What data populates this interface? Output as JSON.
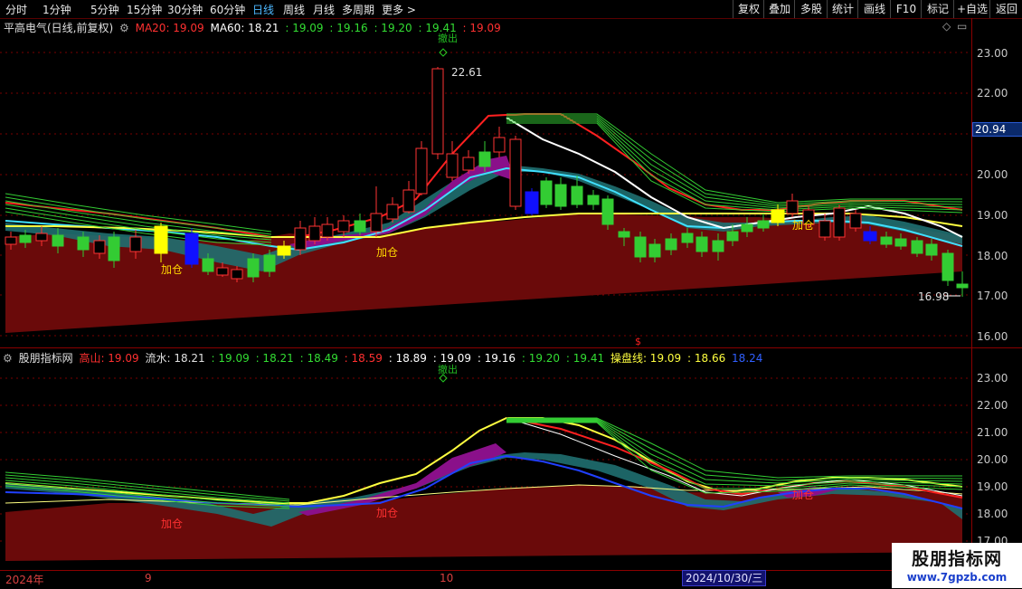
{
  "toolbar": {
    "periods": [
      "分时",
      "1分钟",
      "5分钟",
      "15分钟",
      "30分钟",
      "60分钟",
      "日线",
      "周线",
      "月线",
      "多周期",
      "更多 >"
    ],
    "active_period": "日线",
    "right_buttons": [
      "复权",
      "叠加",
      "多股",
      "统计",
      "画线",
      "F10",
      "标记",
      "+自选",
      "返回"
    ]
  },
  "main_legend": {
    "stock_name": "平高电气(日线,前复权)",
    "ma20_label": "MA20: 19.09",
    "ma60_prefix": "MA60: 18.21",
    "values": [
      ": 19.09",
      ": 19.16",
      ": 19.20",
      ": 19.41",
      ": 19.09"
    ]
  },
  "sub_legend": {
    "indicator_name": "股朋指标网",
    "gaoshan_label": "高山: 19.09",
    "liushui_prefix": "流水: 18.21",
    "v1": ": 19.09",
    "v2": ": 18.21",
    "v3": ": 18.49",
    "v4": ": 18.59",
    "v5": ": 18.89",
    "v6": ": 19.09",
    "v7": ": 19.16",
    "v8": ": 19.20",
    "v9": ": 19.41",
    "caopan_label": "操盘线: 19.09",
    "v10": ": 18.66",
    "v11": "18.24"
  },
  "main_axis": [
    "23.00",
    "22.00",
    "21.00",
    "20.00",
    "19.00",
    "18.00",
    "17.00",
    "16.00"
  ],
  "sub_axis": [
    "23.00",
    "22.00",
    "21.00",
    "20.00",
    "19.00",
    "18.00",
    "17.00"
  ],
  "current_price": "20.94",
  "annotations": {
    "high_label": "22.61",
    "low_label": "16.98",
    "jiacang": "加仓",
    "top_marker": "$",
    "signal_text": "撤出"
  },
  "dates": {
    "year": "2024年",
    "sep": "9",
    "oct": "10",
    "selected": "2024/10/30/三"
  },
  "watermark": {
    "title": "股朋指标网",
    "url": "www.7gpzb.com"
  },
  "colors": {
    "up": "#ff3333",
    "down": "#33cc33",
    "ma_white": "#ffffff",
    "ma_red": "#ff2020",
    "ma_cyan": "#40e0ff",
    "ma_yellow": "#ffff40",
    "mountain": "#6a0a0a",
    "purple": "#8a108a",
    "teal": "#1f6f70"
  }
}
